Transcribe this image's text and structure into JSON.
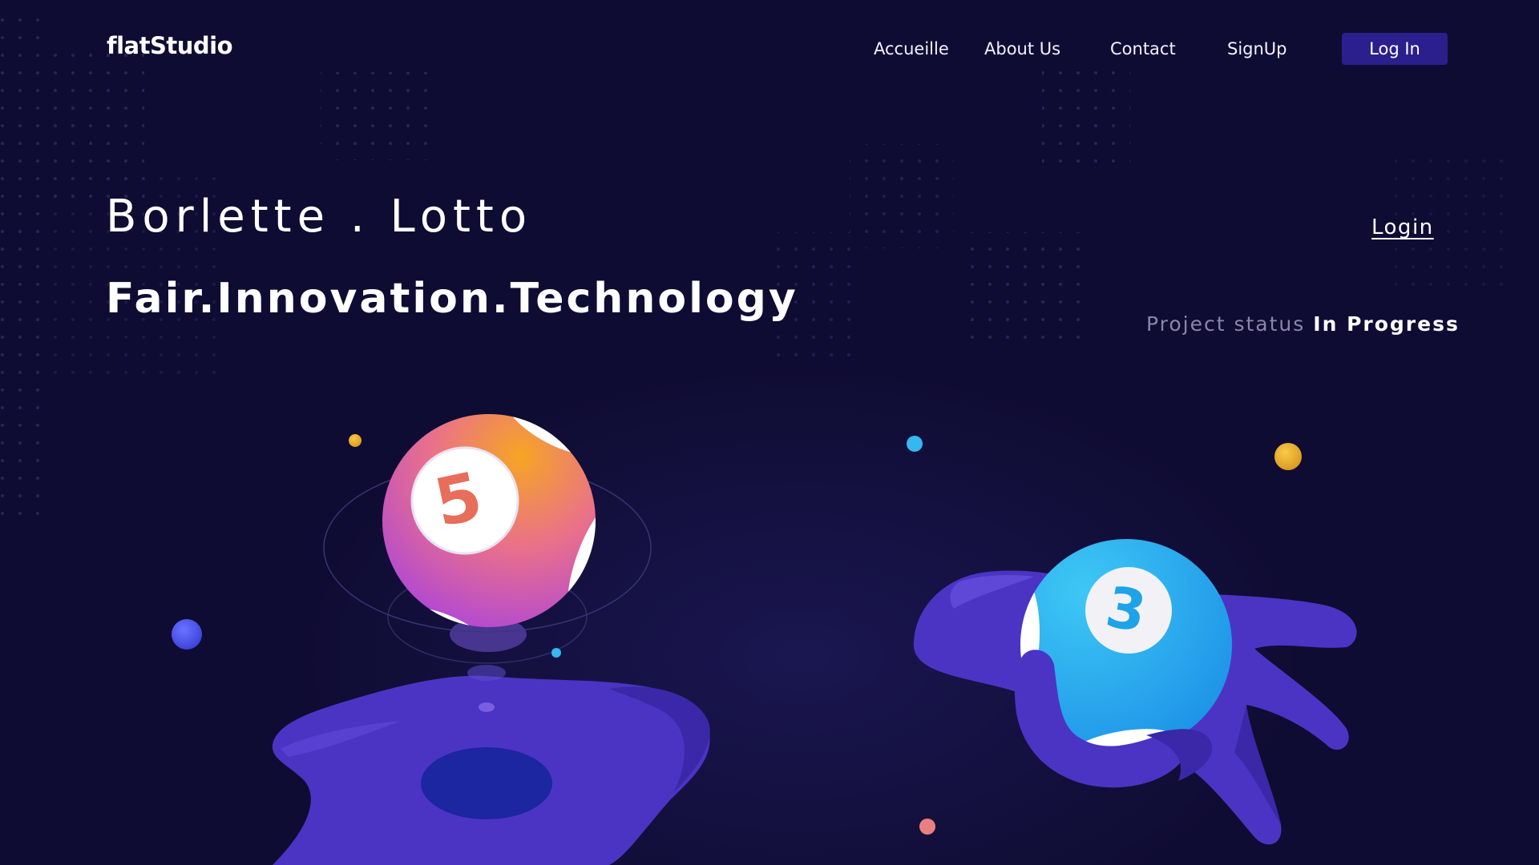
{
  "header": {
    "brand": "flatStudio",
    "nav": [
      {
        "label": "Accueille"
      },
      {
        "label": "About Us"
      },
      {
        "label": "Contact"
      },
      {
        "label": "SignUp"
      }
    ],
    "login_button": "Log In"
  },
  "hero": {
    "title": "Borlette . Lotto",
    "tagline": "Fair.Innovation.Technology",
    "login_link": "Login",
    "status_label": "Project status",
    "status_value": "In Progress"
  },
  "illustration": {
    "ball_left_number": "5",
    "ball_right_number": "3"
  },
  "colors": {
    "background": "#0f0c33",
    "button": "#2b1f8e",
    "hand": "#4b34c4",
    "ball_orange": "#f39a2a",
    "ball_purple": "#b545e0",
    "ball_blue": "#23a6ec",
    "dot_gold": "#e9b033",
    "dot_cyan": "#35b7f0",
    "dot_blue": "#4f5af5"
  }
}
